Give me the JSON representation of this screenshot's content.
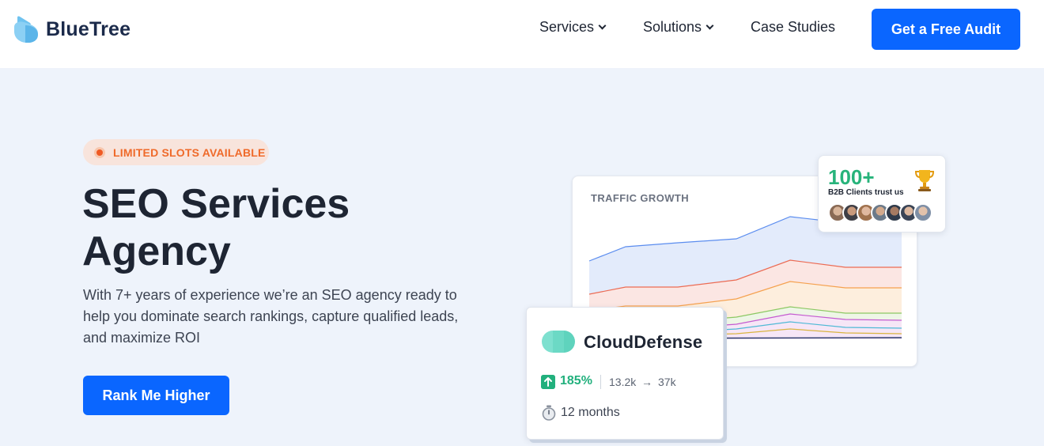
{
  "brand": {
    "name": "BlueTree"
  },
  "nav": {
    "items": [
      {
        "label": "Services",
        "dropdown": true
      },
      {
        "label": "Solutions",
        "dropdown": true
      },
      {
        "label": "Case Studies",
        "dropdown": false
      }
    ],
    "cta_label": "Get a Free Audit"
  },
  "hero": {
    "badge": "LIMITED SLOTS AVAILABLE",
    "title_line1": "SEO Services",
    "title_line2": "Agency",
    "subtitle": "With 7+ years of experience we’re an SEO agency ready to help you dominate search rankings, capture qualified leads, and maximize ROI",
    "cta_label": "Rank Me Higher"
  },
  "traffic_card": {
    "title": "TRAFFIC GROWTH"
  },
  "trust_card": {
    "count": "100+",
    "label": "B2B Clients trust us",
    "icon": "trophy-icon",
    "avatar_count": 7
  },
  "case_card": {
    "company": "CloudDefense",
    "growth": "185%",
    "from": "13.2k",
    "arrow": "→",
    "to": "37k",
    "duration": "12 months"
  },
  "colors": {
    "primary": "#0a66ff",
    "accent_green": "#22b07d",
    "badge_text": "#ef6a2a",
    "page_bg": "#eef3fb"
  }
}
